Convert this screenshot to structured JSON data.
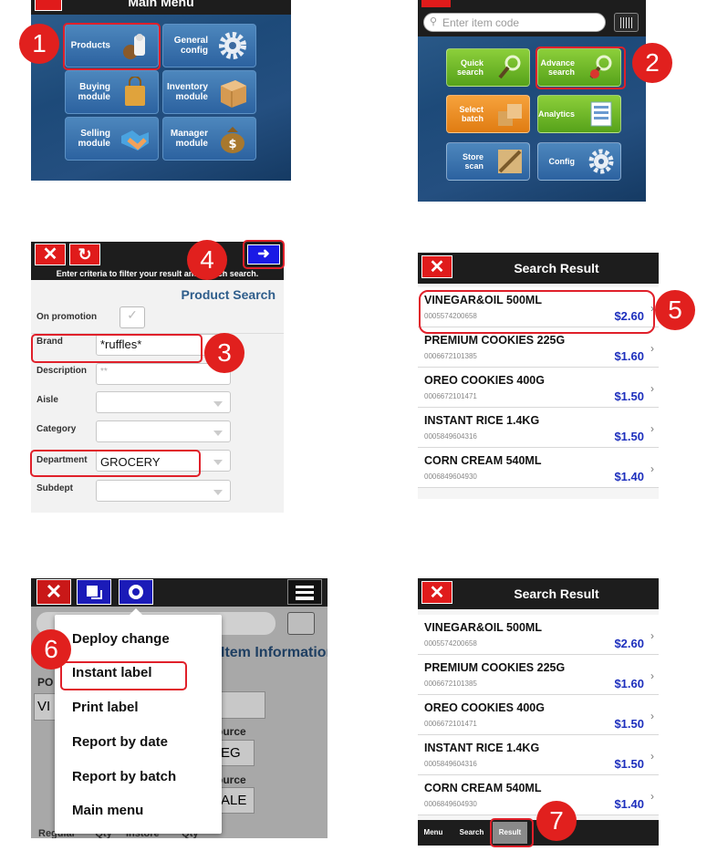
{
  "steps": [
    "1",
    "2",
    "3",
    "4",
    "5",
    "6",
    "7"
  ],
  "main_menu": {
    "title": "Main Menu",
    "tiles": [
      {
        "label": "Products",
        "icon": "products-icon"
      },
      {
        "label": "General\nconfig",
        "icon": "gear-icon"
      },
      {
        "label": "Buying\nmodule",
        "icon": "shopping-bag-icon"
      },
      {
        "label": "Inventory\nmodule",
        "icon": "box-icon"
      },
      {
        "label": "Selling\nmodule",
        "icon": "handshake-icon"
      },
      {
        "label": "Manager\nmodule",
        "icon": "money-bag-icon"
      }
    ]
  },
  "products_menu": {
    "search_placeholder": "Enter item code",
    "tiles": [
      {
        "label": "Quick\nsearch",
        "icon": "magnifier-icon"
      },
      {
        "label": "Advance\nsearch",
        "icon": "advanced-search-icon"
      },
      {
        "label": "Select\nbatch",
        "icon": "batch-icon"
      },
      {
        "label": "Analytics",
        "icon": "analytics-icon"
      },
      {
        "label": "Store\nscan",
        "icon": "scanner-icon"
      },
      {
        "label": "Config",
        "icon": "gear-icon"
      }
    ]
  },
  "product_search": {
    "hint": "Enter criteria to filter your result and launch search.",
    "title": "Product Search",
    "fields": {
      "on_promotion": "On promotion",
      "brand": "Brand",
      "brand_value": "*ruffles*",
      "description": "Description",
      "description_value": "**",
      "aisle": "Aisle",
      "category": "Category",
      "department": "Department",
      "department_value": "GROCERY",
      "subdept": "Subdept"
    }
  },
  "search_result": {
    "title": "Search Result",
    "items": [
      {
        "name": "VINEGAR&OIL 500ML",
        "code": "0005574200658",
        "price": "$2.60"
      },
      {
        "name": "PREMIUM COOKIES 225G",
        "code": "0006672101385",
        "price": "$1.60"
      },
      {
        "name": "OREO COOKIES 400G",
        "code": "0006672101471",
        "price": "$1.50"
      },
      {
        "name": "INSTANT RICE 1.4KG",
        "code": "0005849604316",
        "price": "$1.50"
      },
      {
        "name": "CORN CREAM 540ML",
        "code": "0006849604930",
        "price": "$1.40"
      }
    ]
  },
  "item_menu": {
    "items": [
      "Deploy change",
      "Instant label",
      "Print label",
      "Report by date",
      "Report by batch",
      "Main menu"
    ],
    "bg_title": "Item Information",
    "bg_labels": [
      "PO",
      "VI",
      "ource",
      "EG",
      "ource",
      "ALE",
      "Regular",
      "Qty",
      "Instore",
      "Qty"
    ]
  },
  "result_tabs": [
    "Menu",
    "Search",
    "Result"
  ],
  "colors": {
    "accent_red": "#e1201e",
    "price_blue": "#1d2fbd",
    "header": "#1d1d1d"
  }
}
